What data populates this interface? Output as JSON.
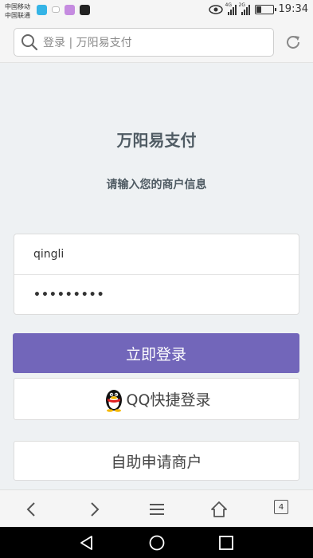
{
  "status_bar": {
    "carrier_1": "中国移动",
    "carrier_2": "中国联通",
    "net_1": "4G",
    "net_2": "2G",
    "time": "19:34"
  },
  "address_bar": {
    "url_text": "登录 | 万阳易支付"
  },
  "main": {
    "site_title": "万阳易支付",
    "subtitle": "请输入您的商户信息",
    "username_value": "qingli",
    "password_value": "•••••••••",
    "login_button": "立即登录",
    "qq_login_button": "QQ快捷登录",
    "apply_button": "自助申请商户"
  },
  "browser_toolbar": {
    "tab_count": "4"
  },
  "colors": {
    "accent": "#7266ba",
    "background": "#eef1f3",
    "title": "#4f5b63"
  }
}
